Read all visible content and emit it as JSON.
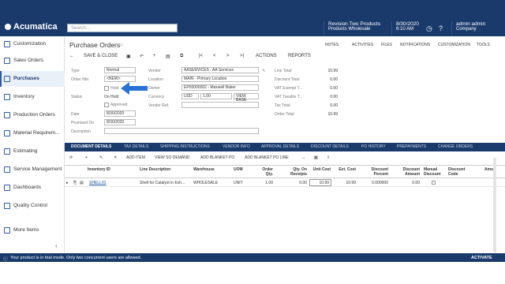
{
  "app": {
    "brand": "Acumatica",
    "search_placeholder": "Search...",
    "company": "Revision Two Products",
    "branch": "Products Wholesale",
    "date": "8/30/2020",
    "time": "6:10 AM",
    "user": "admin admin",
    "user_sub": "Company"
  },
  "sidebar": {
    "items": [
      {
        "label": "Customization"
      },
      {
        "label": "Sales Orders"
      },
      {
        "label": "Purchases"
      },
      {
        "label": "Inventory"
      },
      {
        "label": "Production Orders"
      },
      {
        "label": "Material Requirem..."
      },
      {
        "label": "Estimating"
      },
      {
        "label": "Service Management"
      },
      {
        "label": "Dashboards"
      },
      {
        "label": "Quality Control"
      },
      {
        "label": "More Items"
      }
    ]
  },
  "page": {
    "title": "Purchase Orders",
    "links": [
      "NOTES",
      "ACTIVITIES",
      "FILES",
      "NOTIFICATIONS",
      "CUSTOMIZATION",
      "TOOLS"
    ]
  },
  "toolbar": {
    "save_close": "SAVE & CLOSE",
    "actions": "ACTIONS",
    "reports": "REPORTS"
  },
  "form": {
    "type_label": "Type",
    "type_value": "Normal",
    "order_label": "Order Nbr.",
    "order_value": "<NEW>",
    "hold_label": "Hold",
    "status_label": "Status",
    "status_value": "On Hold",
    "approved_label": "Approved",
    "date_label": "Date",
    "date_value": "8/30/2020",
    "promised_label": "Promised On",
    "promised_value": "8/30/2020",
    "description_label": "Description",
    "vendor_label": "Vendor",
    "vendor_value": "AASERVICES - AA Services",
    "location_label": "Location",
    "location_value": "MAIN - Primary Location",
    "owner_label": "Owner",
    "owner_value": "EP00000002 - Maxwell Baker",
    "currency_label": "Currency",
    "currency_value": "USD",
    "rate_value": "1.00",
    "view_base": "VIEW BASE",
    "vendor_ref_label": "Vendor Ref.",
    "line_total_label": "Line Total",
    "line_total": "10.99",
    "discount_total_label": "Discount Total",
    "discount_total": "0.00",
    "vat_exempt_label": "VAT Exempt T...",
    "vat_exempt": "0.00",
    "vat_taxable_label": "VAT Taxable T...",
    "vat_taxable": "0.00",
    "tax_total_label": "Tax Total",
    "tax_total": "0.00",
    "order_total_label": "Order Total",
    "order_total": "10.99"
  },
  "tabs": [
    "DOCUMENT DETAILS",
    "TAX DETAILS",
    "SHIPPING INSTRUCTIONS",
    "VENDOR INFO",
    "APPROVAL DETAILS",
    "DISCOUNT DETAILS",
    "PO HISTORY",
    "PREPAYMENTS",
    "CHANGE ORDERS"
  ],
  "grid": {
    "buttons": [
      "ADD ITEM",
      "VIEW SO DEMAND",
      "ADD BLANKET PO",
      "ADD BLANKET PO LINE"
    ],
    "headers": [
      "Inventory ID",
      "Line Description",
      "Warehouse",
      "UOM",
      "Order Qty.",
      "Qty. On Receipts",
      "Unit Cost",
      "Ext. Cost",
      "Discount Percent",
      "Discount Amount",
      "Manual Discount",
      "Discount Code",
      "Amou"
    ],
    "row": {
      "inventory_id": "SHELL01",
      "description": "Shell for Catalyst in Exh...",
      "warehouse": "WHOLESALE",
      "uom": "UNIT",
      "order_qty": "1.00",
      "qty_receipts": "0.00",
      "unit_cost": "10.99",
      "ext_cost": "10.99",
      "disc_pct": "0.000000",
      "disc_amt": "0.00"
    }
  },
  "footer": {
    "trial": "Your product is in trial mode. Only two concurrent users are allowed.",
    "activate": "ACTIVATE"
  }
}
